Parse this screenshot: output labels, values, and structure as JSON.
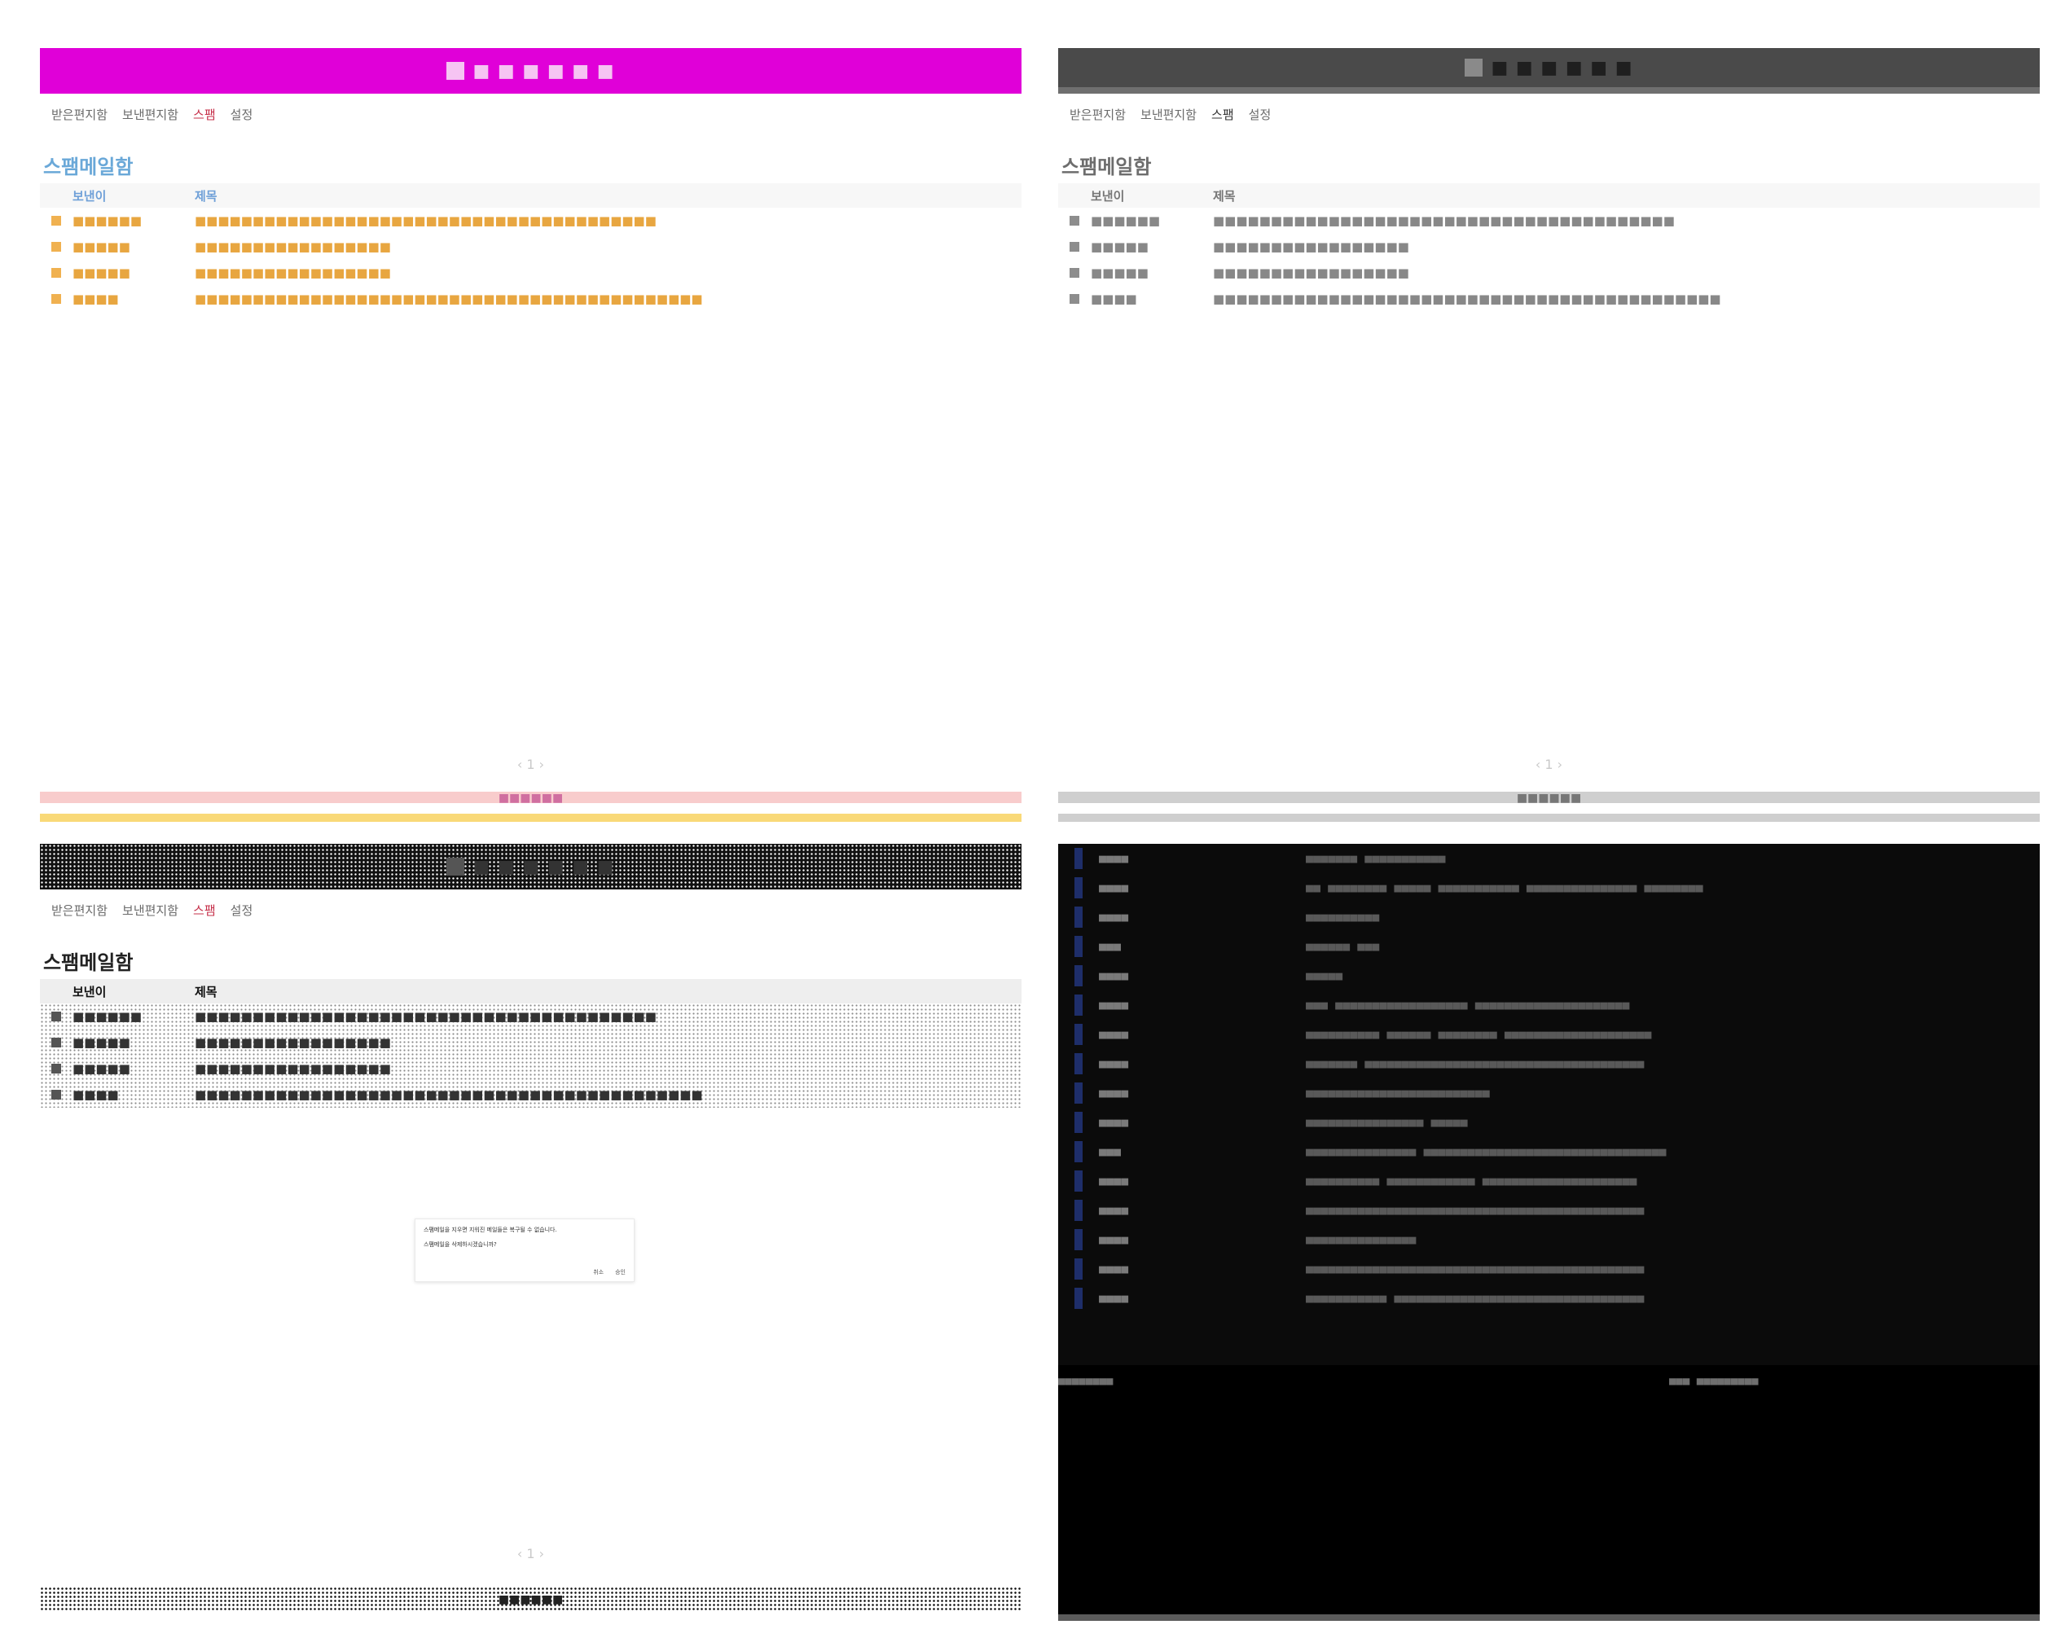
{
  "colors": {
    "q1_title": "#e000d8",
    "q2_title": "#4a4a4a",
    "q1_footer_a": "#f8cccc",
    "q1_footer_b": "#f9d978",
    "terminal_bg": "#0b0b0b",
    "terminal_marker": "#1e2e6a"
  },
  "app": {
    "title": "■ ■ ■ ■ ■ ■",
    "toolbar": [
      "받은편지함",
      "보낸편지함",
      "스팸",
      "설정"
    ],
    "heading": "스팸메일함",
    "columns": [
      "보낸이",
      "제목"
    ],
    "rows": [
      {
        "sender": "■■■■■■",
        "subject": "■■■■■■■■■■■■■■■■■■■■■■■■■■■■■■■■■■■■■■■■"
      },
      {
        "sender": "■■■■■",
        "subject": "■■■■■■■■■■■■■■■■■"
      },
      {
        "sender": "■■■■■",
        "subject": "■■■■■■■■■■■■■■■■■"
      },
      {
        "sender": "■■■■",
        "subject": "■■■■■■■■■■■■■■■■■■■■■■■■■■■■■■■■■■■■■■■■■■■■"
      }
    ],
    "pager": "‹ 1 ›",
    "footer_label": "■■■■■■"
  },
  "dialog": {
    "message1": "스팸메일을 지우면 지워진 메일들은 복구될 수 없습니다.",
    "message2": "스팸메일을 삭제하시겠습니까?",
    "cancel": "취소",
    "confirm": "승인"
  },
  "terminal": {
    "rows": [
      {
        "sender": "■■■■",
        "content": "■■■■■■■ ■■■■■■■■■■■"
      },
      {
        "sender": "■■■■",
        "content": "■■ ■■■■■■■■ ■■■■■ ■■■■■■■■■■■ ■■■■■■■■■■■■■■■ ■■■■■■■■"
      },
      {
        "sender": "■■■■",
        "content": "■■■■■■■■■■"
      },
      {
        "sender": "■■■",
        "content": "■■■■■■ ■■■"
      },
      {
        "sender": "■■■■",
        "content": "■■■■■"
      },
      {
        "sender": "■■■■",
        "content": "■■■ ■■■■■■■■■■■■■■■■■■ ■■■■■■■■■■■■■■■■■■■■■"
      },
      {
        "sender": "■■■■",
        "content": "■■■■■■■■■■ ■■■■■■ ■■■■■■■■ ■■■■■■■■■■■■■■■■■■■■"
      },
      {
        "sender": "■■■■",
        "content": "■■■■■■■ ■■■■■■■■■■■■■■■■■■■■■■■■■■■■■■■■■■■■■■"
      },
      {
        "sender": "■■■■",
        "content": "■■■■■■■■■■■■■■■■■■■■■■■■■"
      },
      {
        "sender": "■■■■",
        "content": "■■■■■■■■■■■■■■■■ ■■■■■"
      },
      {
        "sender": "■■■",
        "content": "■■■■■■■■■■■■■■■ ■■■■■■■■■■■■■■■■■■■■■■■■■■■■■■■■■"
      },
      {
        "sender": "■■■■",
        "content": "■■■■■■■■■■ ■■■■■■■■■■■■ ■■■■■■■■■■■■■■■■■■■■■"
      },
      {
        "sender": "■■■■",
        "content": "■■■■■■■■■■■■■■■■■■■■■■■■■■■■■■■■■■■■■■■■■■■■■■"
      },
      {
        "sender": "■■■■",
        "content": "■■■■■■■■■■■■■■■"
      },
      {
        "sender": "■■■■",
        "content": "■■■■■■■■■■■■■■■■■■■■■■■■■■■■■■■■■■■■■■■■■■■■■■"
      },
      {
        "sender": "■■■■",
        "content": "■■■■■■■■■■■ ■■■■■■■■■■■■■■■■■■■■■■■■■■■■■■■■■■"
      }
    ],
    "status_left": "■■■■■■■■",
    "status_right": "■■■ ■■■■■■■■■"
  }
}
